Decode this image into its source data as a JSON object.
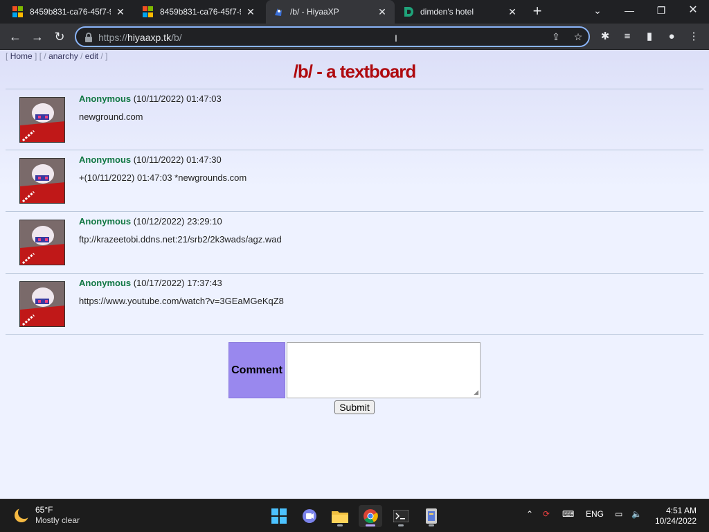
{
  "browser": {
    "tabs": [
      {
        "title": "8459b831-ca76-45f7-9",
        "favicon": "microsoft-icon",
        "active": false
      },
      {
        "title": "8459b831-ca76-45f7-9",
        "favicon": "microsoft-icon",
        "active": false
      },
      {
        "title": "/b/ - HiyaaXP",
        "favicon": "hiyaa-icon",
        "active": true
      },
      {
        "title": "dimden's hotel",
        "favicon": "dimden-icon",
        "active": false
      }
    ],
    "url_scheme": "https://",
    "url_host": "hiyaaxp.tk",
    "url_path": "/b/",
    "accent": "#8ab4f8"
  },
  "page": {
    "crumbs": {
      "open": "[",
      "home": "Home",
      "sep1": "] [ /",
      "anarchy": "anarchy",
      "sep2": "/",
      "edit": "edit",
      "close": "/ ]"
    },
    "title": "/b/ - a textboard",
    "title_color": "#af0a0f",
    "posts": [
      {
        "name": "Anonymous",
        "date": "(10/11/2022) 01:47:03",
        "body": "newground.com"
      },
      {
        "name": "Anonymous",
        "date": "(10/11/2022) 01:47:30",
        "body": "+(10/11/2022) 01:47:03 *newgrounds.com"
      },
      {
        "name": "Anonymous",
        "date": "(10/12/2022) 23:29:10",
        "body": "ftp://krazeetobi.ddns.net:21/srb2/2k3wads/agz.wad"
      },
      {
        "name": "Anonymous",
        "date": "(10/17/2022) 17:37:43",
        "body": "https://www.youtube.com/watch?v=3GEaMGeKqZ8"
      }
    ],
    "form": {
      "label": "Comment",
      "value": "",
      "submit": "Submit"
    }
  },
  "taskbar": {
    "weather_temp": "65°F",
    "weather_cond": "Mostly clear",
    "lang": "ENG",
    "time": "4:51 AM",
    "date": "10/24/2022"
  }
}
